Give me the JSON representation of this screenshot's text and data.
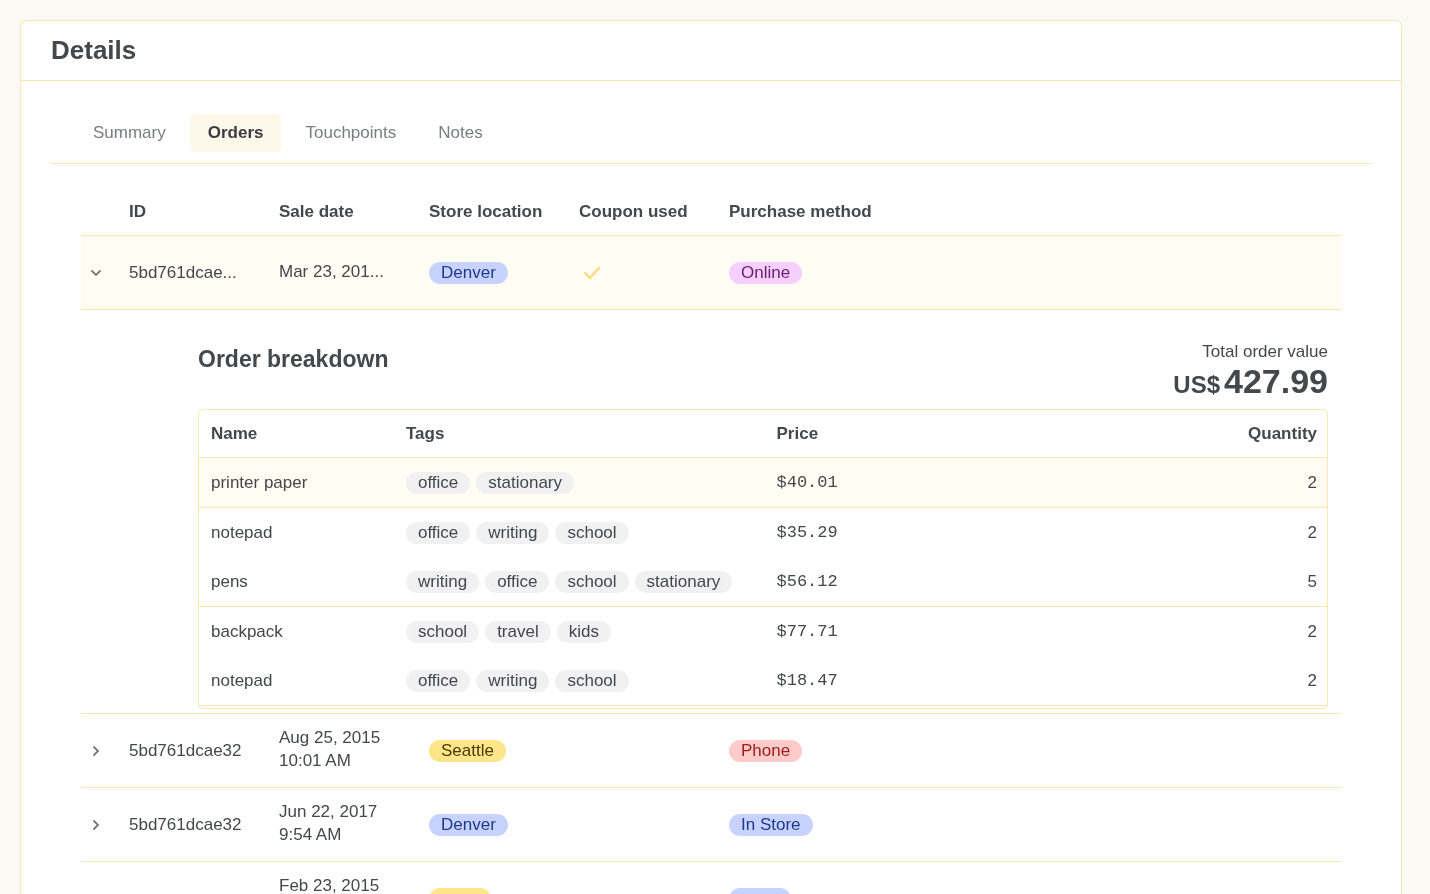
{
  "card": {
    "title": "Details"
  },
  "tabs": [
    {
      "label": "Summary",
      "selected": false
    },
    {
      "label": "Orders",
      "selected": true
    },
    {
      "label": "Touchpoints",
      "selected": false
    },
    {
      "label": "Notes",
      "selected": false
    }
  ],
  "orders": {
    "columns": [
      "ID",
      "Sale date",
      "Store location",
      "Coupon used",
      "Purchase method"
    ],
    "rows": [
      {
        "id": "5bd761dcae...",
        "date": [
          "Mar 23, 201..."
        ],
        "store": {
          "label": "Denver",
          "color": "#c7d2fe"
        },
        "coupon": true,
        "method": {
          "label": "Online",
          "color": "#f5d0fe"
        },
        "expanded": true,
        "highlighted": true
      },
      {
        "id": "5bd761dcae32",
        "date": [
          "Aug 25, 2015",
          "10:01 AM"
        ],
        "store": {
          "label": "Seattle",
          "color": "#fde68a"
        },
        "coupon": false,
        "method": {
          "label": "Phone",
          "color": "#fecaca"
        },
        "expanded": false,
        "highlighted": false
      },
      {
        "id": "5bd761dcae32",
        "date": [
          "Jun 22, 2017",
          "9:54 AM"
        ],
        "store": {
          "label": "Denver",
          "color": "#c7d2fe"
        },
        "coupon": false,
        "method": {
          "label": "In Store",
          "color": "#c7d2fe"
        },
        "expanded": false,
        "highlighted": false
      },
      {
        "date": [
          "Feb 23, 2015"
        ],
        "store": {
          "color": "#fde68a"
        },
        "coupon": false,
        "method": {
          "color": "#c7d2fe"
        },
        "expanded": false,
        "highlighted": false
      }
    ]
  },
  "breakdown": {
    "title": "Order breakdown",
    "total_label": "Total order value",
    "currency": "US$",
    "total": "427.99",
    "columns": [
      "Name",
      "Tags",
      "Price",
      "Quantity"
    ],
    "groups": [
      [
        {
          "name": "printer paper",
          "tags": [
            "office",
            "stationary"
          ],
          "price": "$40.01",
          "quantity": "2",
          "highlighted": true
        }
      ],
      [
        {
          "name": "notepad",
          "tags": [
            "office",
            "writing",
            "school"
          ],
          "price": "$35.29",
          "quantity": "2",
          "highlighted": false
        },
        {
          "name": "pens",
          "tags": [
            "writing",
            "office",
            "school",
            "stationary"
          ],
          "price": "$56.12",
          "quantity": "5",
          "highlighted": false
        }
      ],
      [
        {
          "name": "backpack",
          "tags": [
            "school",
            "travel",
            "kids"
          ],
          "price": "$77.71",
          "quantity": "2",
          "highlighted": false
        },
        {
          "name": "notepad",
          "tags": [
            "office",
            "writing",
            "school"
          ],
          "price": "$18.47",
          "quantity": "2",
          "highlighted": false
        }
      ]
    ]
  }
}
